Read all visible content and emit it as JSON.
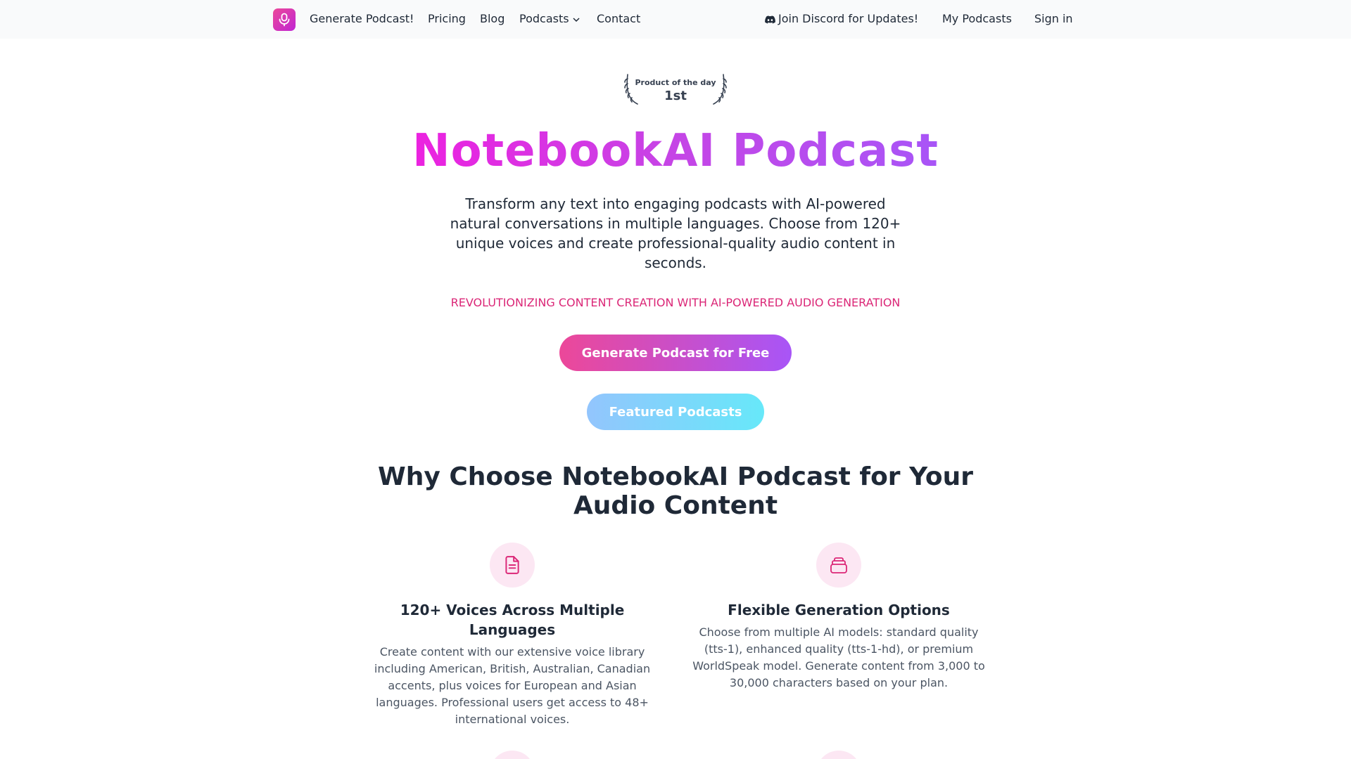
{
  "nav": {
    "links": [
      "Generate Podcast!",
      "Pricing",
      "Blog",
      "Podcasts",
      "Contact"
    ],
    "discord": "Join Discord for Updates!",
    "my_podcasts": "My Podcasts",
    "sign_in": "Sign in",
    "brand_color": "#ec4899"
  },
  "badge": {
    "label": "Product of the day",
    "rank": "1st"
  },
  "hero": {
    "title": "NotebookAI Podcast",
    "description": "Transform any text into engaging podcasts with AI-powered natural conversations in multiple languages. Choose from 120+ unique voices and create professional-quality audio content in seconds.",
    "tagline": "REVOLUTIONIZING CONTENT CREATION WITH AI-POWERED AUDIO GENERATION",
    "primary_cta": "Generate Podcast for Free",
    "secondary_cta": "Featured Podcasts"
  },
  "why": {
    "title": "Why Choose NotebookAI Podcast for Your Audio Content",
    "features": [
      {
        "icon": "document-icon",
        "title": "120+ Voices Across Multiple Languages",
        "description": "Create content with our extensive voice library including American, British, Australian, Canadian accents, plus voices for European and Asian languages. Professional users get access to 48+ international voices."
      },
      {
        "icon": "stack-icon",
        "title": "Flexible Generation Options",
        "description": "Choose from multiple AI models: standard quality (tts-1), enhanced quality (tts-1-hd), or premium WorldSpeak model. Generate content from 3,000 to 30,000 characters based on your plan."
      }
    ]
  }
}
